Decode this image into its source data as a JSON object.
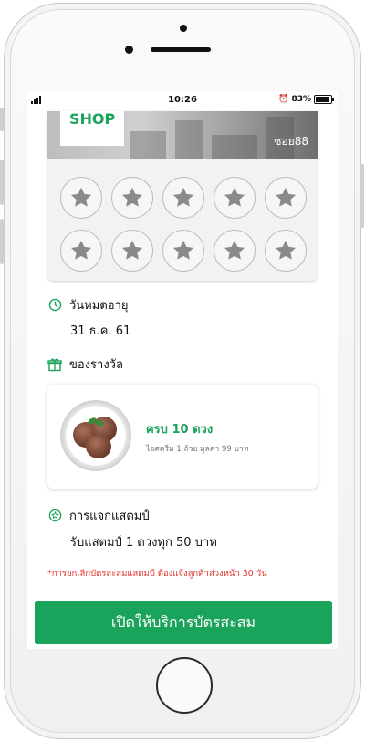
{
  "status_bar": {
    "time": "10:26",
    "alarm": "⏰",
    "battery": "83%"
  },
  "card": {
    "shop_logo": "SHOP",
    "shop_name": "ซอย88",
    "stamp_count": 10,
    "stamp_icon": "star-icon"
  },
  "expiry": {
    "label": "วันหมดอายุ",
    "value": "31 ธ.ค. 61",
    "icon": "clock-icon"
  },
  "reward": {
    "label": "ของรางวัล",
    "icon": "gift-icon",
    "title": "ครบ 10 ดวง",
    "description": "ไอศครีม 1 ถ้วย มูลค่า 99 บาท"
  },
  "stamp_rule": {
    "label": "การแจกแสตมป์",
    "value": "รับแสตมป์ 1 ดวงทุก 50 บาท",
    "icon": "stamp-star-icon"
  },
  "notice": "*การยกเลิกบัตรสะสมแสตมป์ ต้องแจ้งลูกค้าล่วงหน้า 30 วัน",
  "cta_label": "เปิดให้บริการบัตรสะสม",
  "colors": {
    "accent": "#1aa35a",
    "warning": "#e2332b"
  }
}
